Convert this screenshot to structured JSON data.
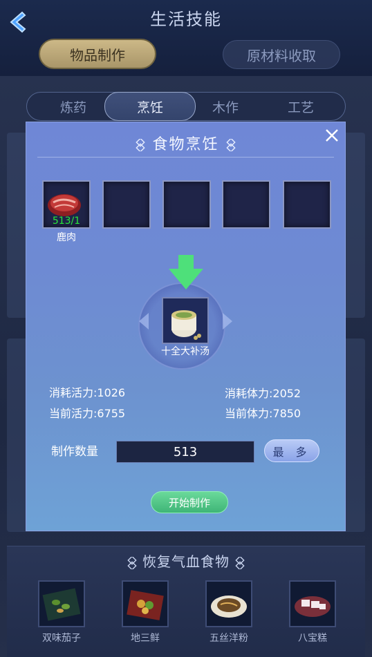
{
  "header": {
    "title": "生活技能"
  },
  "mode_tabs": [
    {
      "label": "物品制作",
      "active": true
    },
    {
      "label": "原材料收取",
      "active": false
    }
  ],
  "skill_tabs": [
    {
      "label": "炼药",
      "active": false
    },
    {
      "label": "烹饪",
      "active": true
    },
    {
      "label": "木作",
      "active": false
    },
    {
      "label": "工艺",
      "active": false
    }
  ],
  "modal": {
    "title": "食物烹饪",
    "ingredients": [
      {
        "name": "鹿肉",
        "count": "513/1",
        "icon": "venison-icon"
      }
    ],
    "product": {
      "name": "十全大补汤",
      "icon": "soup-pot-icon"
    },
    "stats": {
      "energy_cost": "消耗活力:1026",
      "stamina_cost": "消耗体力:2052",
      "energy_current": "当前活力:6755",
      "stamina_current": "当前体力:7850"
    },
    "quantity_label": "制作数量",
    "quantity_value": "513",
    "max_label": "最 多",
    "start_label": "开始制作"
  },
  "food_section": {
    "title": "恢复气血食物",
    "items": [
      {
        "name": "双味茄子"
      },
      {
        "name": "地三鲜"
      },
      {
        "name": "五丝洋粉"
      },
      {
        "name": "八宝糕"
      }
    ]
  },
  "colors": {
    "accent_gold": "#ccb887",
    "modal_blue": "#6f87d6",
    "count_green": "#27e83a",
    "start_green": "#4fc685"
  }
}
